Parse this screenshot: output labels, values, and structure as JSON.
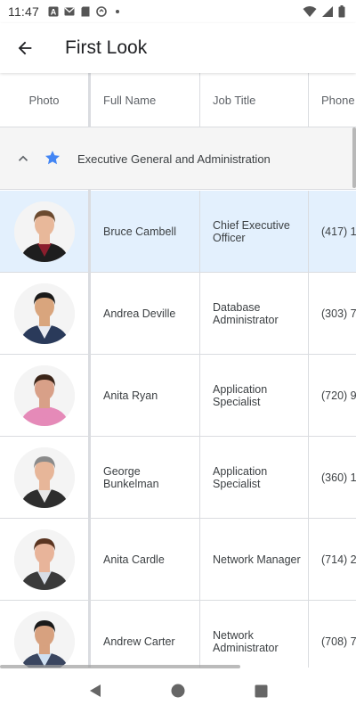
{
  "status_bar": {
    "time": "11:47"
  },
  "app_bar": {
    "title": "First Look"
  },
  "grid": {
    "columns": [
      {
        "key": "photo",
        "label": "Photo"
      },
      {
        "key": "name",
        "label": "Full Name"
      },
      {
        "key": "job",
        "label": "Job Title"
      },
      {
        "key": "phone",
        "label": "Phone"
      }
    ],
    "group": {
      "label": "Executive General and Administration",
      "expanded": true
    },
    "rows": [
      {
        "name": "Bruce Cambell",
        "job": "Chief Executive Officer",
        "phone": "(417) 1",
        "selected": true,
        "skin": "#e8b89a",
        "hair": "#6b4a2f",
        "shirt": "#8b1e2d",
        "jacket": "#1e1e1e"
      },
      {
        "name": "Andrea Deville",
        "job": "Database Administrator",
        "phone": "(303) 7",
        "selected": false,
        "skin": "#d9a57d",
        "hair": "#1a1a1a",
        "shirt": "#e8eaf0",
        "jacket": "#2a3a5a"
      },
      {
        "name": "Anita Ryan",
        "job": "Application Specialist",
        "phone": "(720) 9",
        "selected": false,
        "skin": "#d8a088",
        "hair": "#3a2418",
        "shirt": "#e58ab8",
        "jacket": "#e58ab8"
      },
      {
        "name": "George Bunkelman",
        "job": "Application Specialist",
        "phone": "(360) 1",
        "selected": false,
        "skin": "#e7b699",
        "hair": "#8a8a8a",
        "shirt": "#e8e8e8",
        "jacket": "#2e2e2e"
      },
      {
        "name": "Anita Cardle",
        "job": "Network Manager",
        "phone": "(714) 2",
        "selected": false,
        "skin": "#e8b49a",
        "hair": "#5a3420",
        "shirt": "#d8dde6",
        "jacket": "#3a3a3a"
      },
      {
        "name": "Andrew Carter",
        "job": "Network Administrator",
        "phone": "(708) 7",
        "selected": false,
        "skin": "#d7a17f",
        "hair": "#1a1a1a",
        "shirt": "#cfe0f2",
        "jacket": "#3a4660"
      }
    ]
  },
  "colors": {
    "accent": "#4285f4",
    "selected_row": "#e3f0fd",
    "group_bg": "#f5f5f5"
  }
}
